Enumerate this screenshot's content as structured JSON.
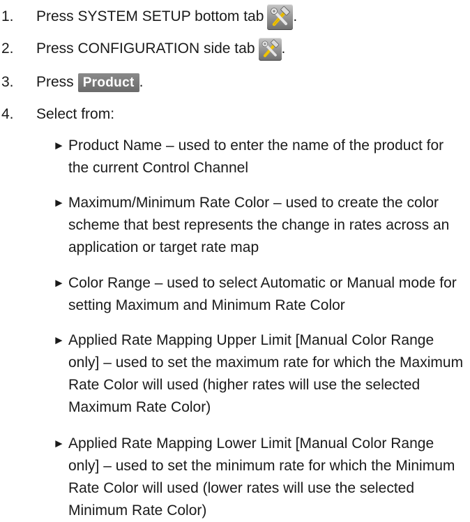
{
  "steps": [
    {
      "num": "1.",
      "text": "Press SYSTEM SETUP bottom tab",
      "suffix": "."
    },
    {
      "num": "2.",
      "text": "Press CONFIGURATION side tab",
      "suffix": "."
    },
    {
      "num": "3.",
      "text": "Press",
      "button": "Product",
      "suffix": "."
    },
    {
      "num": "4.",
      "text": "Select from:"
    }
  ],
  "bullet_glyph": "►",
  "bullets": [
    {
      "text": "Product Name – used to enter the name of the product for the current Control Channel"
    },
    {
      "text": "Maximum/Minimum Rate Color – used to create the color scheme that best represents the change in rates across an application or target rate map"
    },
    {
      "text": "Color Range – used to select Automatic or Manual mode for setting Maximum and Minimum Rate Color"
    },
    {
      "text": "Applied Rate Mapping Upper Limit [Manual Color Range only] – used to set the maximum rate for which the Maximum Rate Color will used (higher rates will use the selected Maximum Rate Color)"
    },
    {
      "text": "Applied Rate Mapping Lower Limit [Manual Color Range only] – used to set the minimum rate for which the Minimum Rate Color will used (lower rates will use the selected Minimum Rate Color)"
    }
  ],
  "icons": {
    "system_setup_tab": "wrench-hammer-icon",
    "configuration_tab": "wrench-hammer-icon"
  }
}
